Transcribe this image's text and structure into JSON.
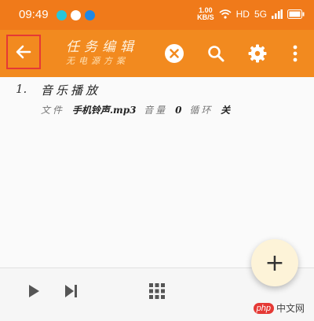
{
  "status_bar": {
    "time": "09:49",
    "net_speed_value": "1.00",
    "net_speed_unit": "KB/S",
    "network_label": "HD",
    "signal_label": "5G",
    "battery_icon": "battery-icon"
  },
  "toolbar": {
    "title": "任务编辑",
    "subtitle": "无电源方案",
    "back_icon": "arrow-left-icon",
    "close_icon": "close-circle-icon",
    "search_icon": "search-icon",
    "settings_icon": "gear-icon",
    "more_icon": "more-vertical-icon"
  },
  "tasks": [
    {
      "number": "1.",
      "name": "音乐播放",
      "file_label": "文件",
      "file_value": "手机铃声.mp3",
      "volume_label": "音量",
      "volume_value": "0",
      "loop_label": "循环",
      "loop_value": "关"
    }
  ],
  "fab": {
    "label": "+"
  },
  "bottom_bar": {
    "play_icon": "play-icon",
    "skip_icon": "skip-next-icon",
    "grid_icon": "grid-icon"
  },
  "watermark": {
    "logo": "php",
    "text": "中文网"
  },
  "colors": {
    "primary": "#f28a1f",
    "status_bar": "#f07a1a",
    "highlight_border": "#e53935"
  }
}
